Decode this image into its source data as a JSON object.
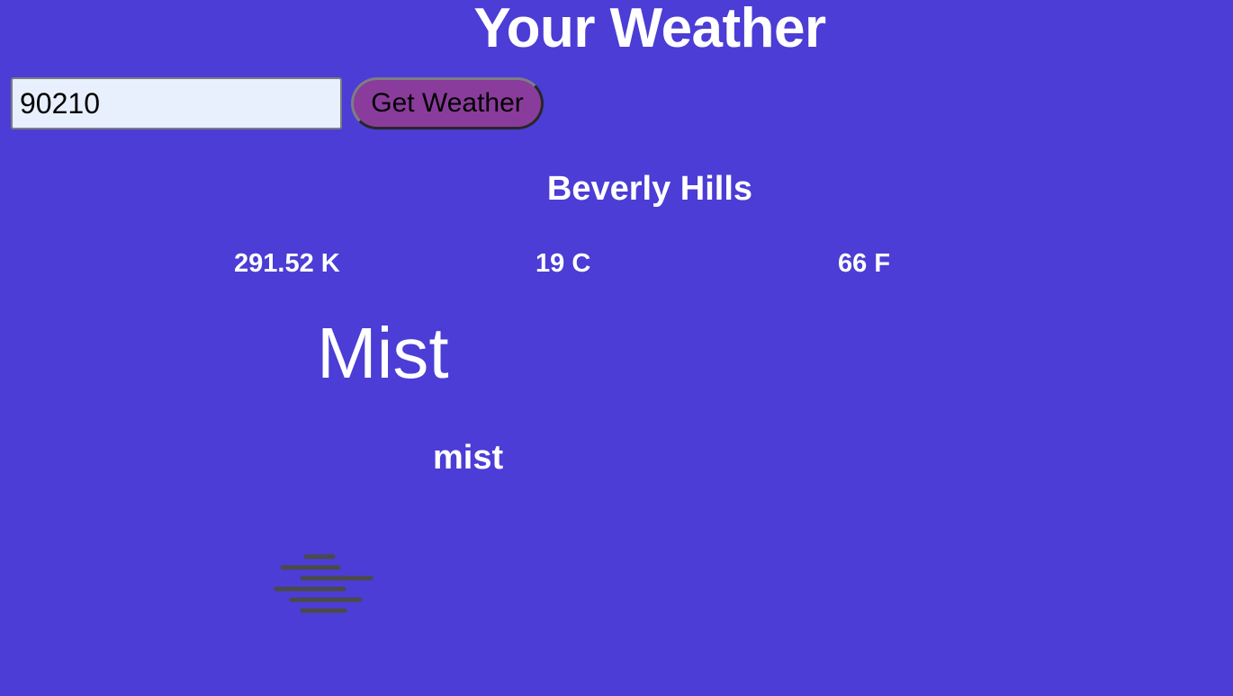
{
  "header": {
    "title": "Your Weather"
  },
  "search": {
    "zip_value": "90210",
    "button_label": "Get Weather"
  },
  "weather": {
    "city": "Beverly Hills",
    "temp_kelvin": "291.52 K",
    "temp_celsius": "19 C",
    "temp_fahrenheit": "66 F",
    "main": "Mist",
    "description": "mist",
    "icon": "mist-icon"
  },
  "colors": {
    "background": "#4b3dd5",
    "button": "#8a3c9c",
    "input_background": "#e9f0fd",
    "text": "#ffffff",
    "icon_stroke": "#4a4a4a"
  }
}
